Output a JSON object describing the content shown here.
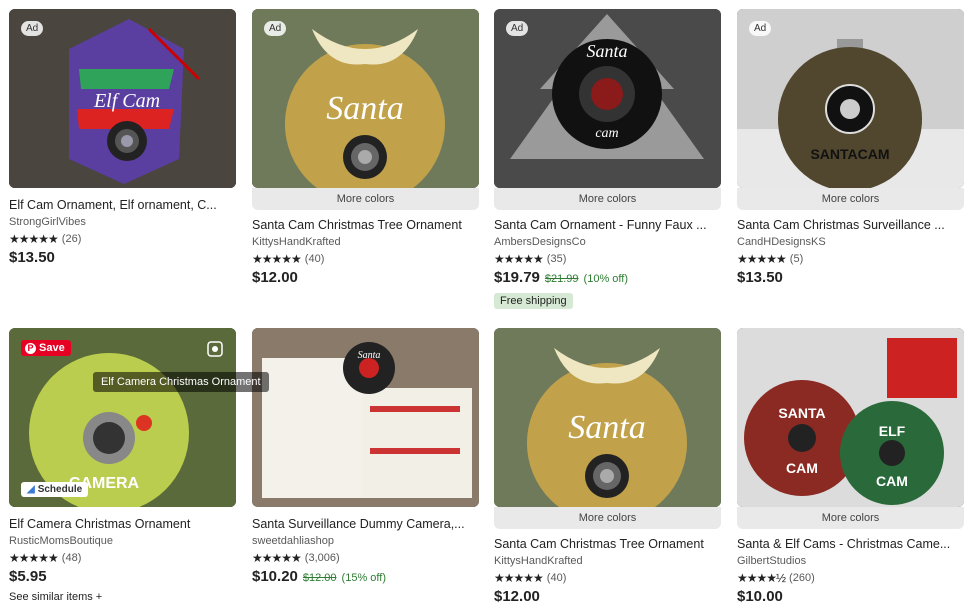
{
  "cards": [
    {
      "title": "Elf Cam Ornament, Elf ornament, C...",
      "shop": "StrongGirlVibes",
      "stars": "★★★★★",
      "reviews": "(26)",
      "price": "$13.50",
      "ad": "Ad",
      "art": {
        "bg": "#3b3b3b",
        "label": "Elf Cam"
      }
    },
    {
      "title": "Santa Cam Christmas Tree Ornament",
      "shop": "KittysHandKrafted",
      "stars": "★★★★★",
      "reviews": "(40)",
      "price": "$12.00",
      "ad": "Ad",
      "more_colors": "More colors",
      "art": {
        "bg": "#6f7a5b",
        "label": "Santa"
      }
    },
    {
      "title": "Santa Cam Ornament - Funny Faux ...",
      "shop": "AmbersDesignsCo",
      "stars": "★★★★★",
      "reviews": "(35)",
      "price": "$19.79",
      "orig_price": "$21.99",
      "discount": "(10% off)",
      "free_shipping": "Free shipping",
      "ad": "Ad",
      "more_colors": "More colors",
      "art": {
        "bg": "#4a4a4a",
        "label": "Santa cam"
      }
    },
    {
      "title": "Santa Cam Christmas Surveillance ...",
      "shop": "CandHDesignsKS",
      "stars": "★★★★★",
      "reviews": "(5)",
      "price": "$13.50",
      "ad": "Ad",
      "more_colors": "More colors",
      "art": {
        "bg": "#cfcfcf",
        "label": "SANTACAM"
      }
    },
    {
      "title": "Elf Camera Christmas Ornament",
      "shop": "RusticMomsBoutique",
      "stars": "★★★★★",
      "reviews": "(48)",
      "price": "$5.95",
      "similar": "See similar items +",
      "save": "Save",
      "tooltip": "Elf Camera Christmas Ornament",
      "schedule": "Schedule",
      "art": {
        "bg": "#5a6a3a",
        "label": "ELF CAMERA"
      }
    },
    {
      "title": "Santa Surveillance Dummy Camera,...",
      "shop": "sweetdahliashop",
      "stars": "★★★★★",
      "reviews": "(3,006)",
      "price": "$10.20",
      "orig_price": "$12.00",
      "discount": "(15% off)",
      "art": {
        "bg": "#8a7a6a",
        "label": "Santa Cam"
      }
    },
    {
      "title": "Santa Cam Christmas Tree Ornament",
      "shop": "KittysHandKrafted",
      "stars": "★★★★★",
      "reviews": "(40)",
      "price": "$12.00",
      "more_colors": "More colors",
      "art": {
        "bg": "#6f7a5b",
        "label": "Santa"
      }
    },
    {
      "title": "Santa & Elf Cams - Christmas Came...",
      "shop": "GilbertStudios",
      "stars": "★★★★½",
      "reviews": "(260)",
      "price": "$10.00",
      "more_colors": "More colors",
      "art": {
        "bg": "#dcdcdc",
        "label": "SANTA CAM / ELF CAM"
      }
    }
  ],
  "colors": {
    "accent_green": "#2e7d32",
    "pinterest_red": "#e60023",
    "free_bg": "#d6e9d4"
  }
}
